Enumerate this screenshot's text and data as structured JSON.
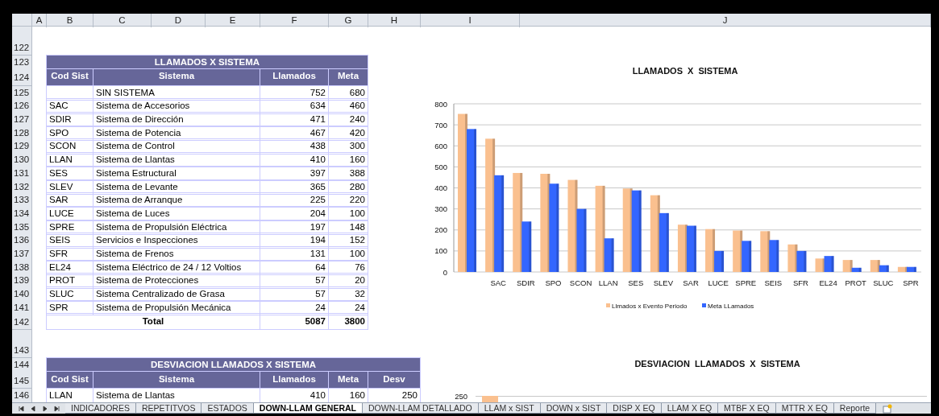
{
  "column_headers": [
    "A",
    "B",
    "C",
    "D",
    "E",
    "F",
    "G",
    "H",
    "I",
    "J"
  ],
  "row_numbers": [
    "122",
    "123",
    "124",
    "125",
    "126",
    "127",
    "128",
    "129",
    "130",
    "131",
    "132",
    "133",
    "134",
    "135",
    "136",
    "137",
    "138",
    "139",
    "140",
    "141",
    "142",
    "143",
    "144",
    "145",
    "146"
  ],
  "table1": {
    "title": "LLAMADOS X SISTEMA",
    "columns": [
      "Cod Sist",
      "Sistema",
      "Llamados",
      "Meta"
    ],
    "rows": [
      {
        "system": "SIN SISTEMA",
        "calls": "752",
        "goal": "680"
      },
      {
        "code": "SAC",
        "system": "Sistema de Accesorios",
        "calls": "634",
        "goal": "460"
      },
      {
        "code": "SDIR",
        "system": "Sistema de Dirección",
        "calls": "471",
        "goal": "240"
      },
      {
        "code": "SPO",
        "system": "Sistema de Potencia",
        "calls": "467",
        "goal": "420"
      },
      {
        "code": "SCON",
        "system": "Sistema de Control",
        "calls": "438",
        "goal": "300"
      },
      {
        "code": "LLAN",
        "system": "Sistema de Llantas",
        "calls": "410",
        "goal": "160"
      },
      {
        "code": "SES",
        "system": "Sistema Estructural",
        "calls": "397",
        "goal": "388"
      },
      {
        "code": "SLEV",
        "system": "Sistema de Levante",
        "calls": "365",
        "goal": "280"
      },
      {
        "code": "SAR",
        "system": "Sistema de Arranque",
        "calls": "225",
        "goal": "220"
      },
      {
        "code": "LUCE",
        "system": "Sistema de Luces",
        "calls": "204",
        "goal": "100"
      },
      {
        "code": "SPRE",
        "system": "Sistema de Propulsión Eléctrica",
        "calls": "197",
        "goal": "148"
      },
      {
        "code": "SEIS",
        "system": "Servicios e Inspecciones",
        "calls": "194",
        "goal": "152"
      },
      {
        "code": "SFR",
        "system": "Sistema de Frenos",
        "calls": "131",
        "goal": "100"
      },
      {
        "code": "EL24",
        "system": "Sistema Eléctrico de 24 / 12 Voltios",
        "calls": "64",
        "goal": "76"
      },
      {
        "code": "PROT",
        "system": "Sistema de Protecciones",
        "calls": "57",
        "goal": "20"
      },
      {
        "code": "SLUC",
        "system": "Sistema Centralizado de Grasa",
        "calls": "57",
        "goal": "32"
      },
      {
        "code": "SPR",
        "system": "Sistema de Propulsión Mecánica",
        "calls": "24",
        "goal": "24"
      }
    ],
    "total": {
      "label": "Total",
      "calls": "5087",
      "goal": "3800"
    }
  },
  "table2": {
    "title": "DESVIACION LLAMADOS X SISTEMA",
    "columns": [
      "Cod Sist",
      "Sistema",
      "Llamados",
      "Meta",
      "Desv"
    ],
    "rows": [
      {
        "code": "LLAN",
        "system": "Sistema de Llantas",
        "calls": "410",
        "goal": "160",
        "desv": "250"
      }
    ]
  },
  "chart": {
    "chart_data": {
      "type": "bar",
      "title": "LLAMADOS X SISTEMA",
      "categories": [
        null,
        "SAC",
        "SDIR",
        "SPO",
        "SCON",
        "LLAN",
        "SES",
        "SLEV",
        "SAR",
        "LUCE",
        "SPRE",
        "SEIS",
        "SFR",
        "EL24",
        "PROT",
        "SLUC",
        "SPR"
      ],
      "series": [
        {
          "name": "Llmados x Evento Periodo",
          "color": "#fac08f",
          "values": [
            752,
            634,
            471,
            467,
            438,
            410,
            397,
            365,
            225,
            204,
            197,
            194,
            131,
            64,
            57,
            57,
            24
          ]
        },
        {
          "name": "Meta LLamados",
          "color": "#3366ff",
          "values": [
            680,
            460,
            240,
            420,
            300,
            160,
            388,
            280,
            220,
            100,
            148,
            152,
            100,
            76,
            20,
            32,
            24
          ]
        }
      ],
      "grid": true,
      "legend": true,
      "ylim": [
        0,
        800
      ],
      "yticks": [
        {
          "value": 0,
          "label": "0"
        },
        {
          "value": 100,
          "label": "100"
        },
        {
          "value": 200,
          "label": "200"
        },
        {
          "value": 300,
          "label": "300"
        },
        {
          "value": 400,
          "label": "400"
        },
        {
          "value": 500,
          "label": "500"
        },
        {
          "value": 600,
          "label": "600"
        },
        {
          "value": 700,
          "label": "700"
        },
        {
          "value": 800,
          "label": "800"
        }
      ]
    }
  },
  "chart2": {
    "title": "DESVIACION LLAMADOS X SISTEMA",
    "tick_label": "250"
  },
  "sheet_tabs": [
    {
      "label": "INDICADORES",
      "selected": false
    },
    {
      "label": "REPETITVOS",
      "selected": false
    },
    {
      "label": "ESTADOS",
      "selected": false
    },
    {
      "label": "DOWN-LLAM GENERAL",
      "selected": true
    },
    {
      "label": "DOWN-LLAM DETALLADO",
      "selected": false
    },
    {
      "label": "LLAM x SIST",
      "selected": false
    },
    {
      "label": "DOWN x SIST",
      "selected": false
    },
    {
      "label": "DISP X EQ",
      "selected": false
    },
    {
      "label": "LLAM X EQ",
      "selected": false
    },
    {
      "label": "MTBF X EQ",
      "selected": false
    },
    {
      "label": "MTTR X EQ",
      "selected": false
    },
    {
      "label": "Reporte",
      "selected": false
    }
  ]
}
